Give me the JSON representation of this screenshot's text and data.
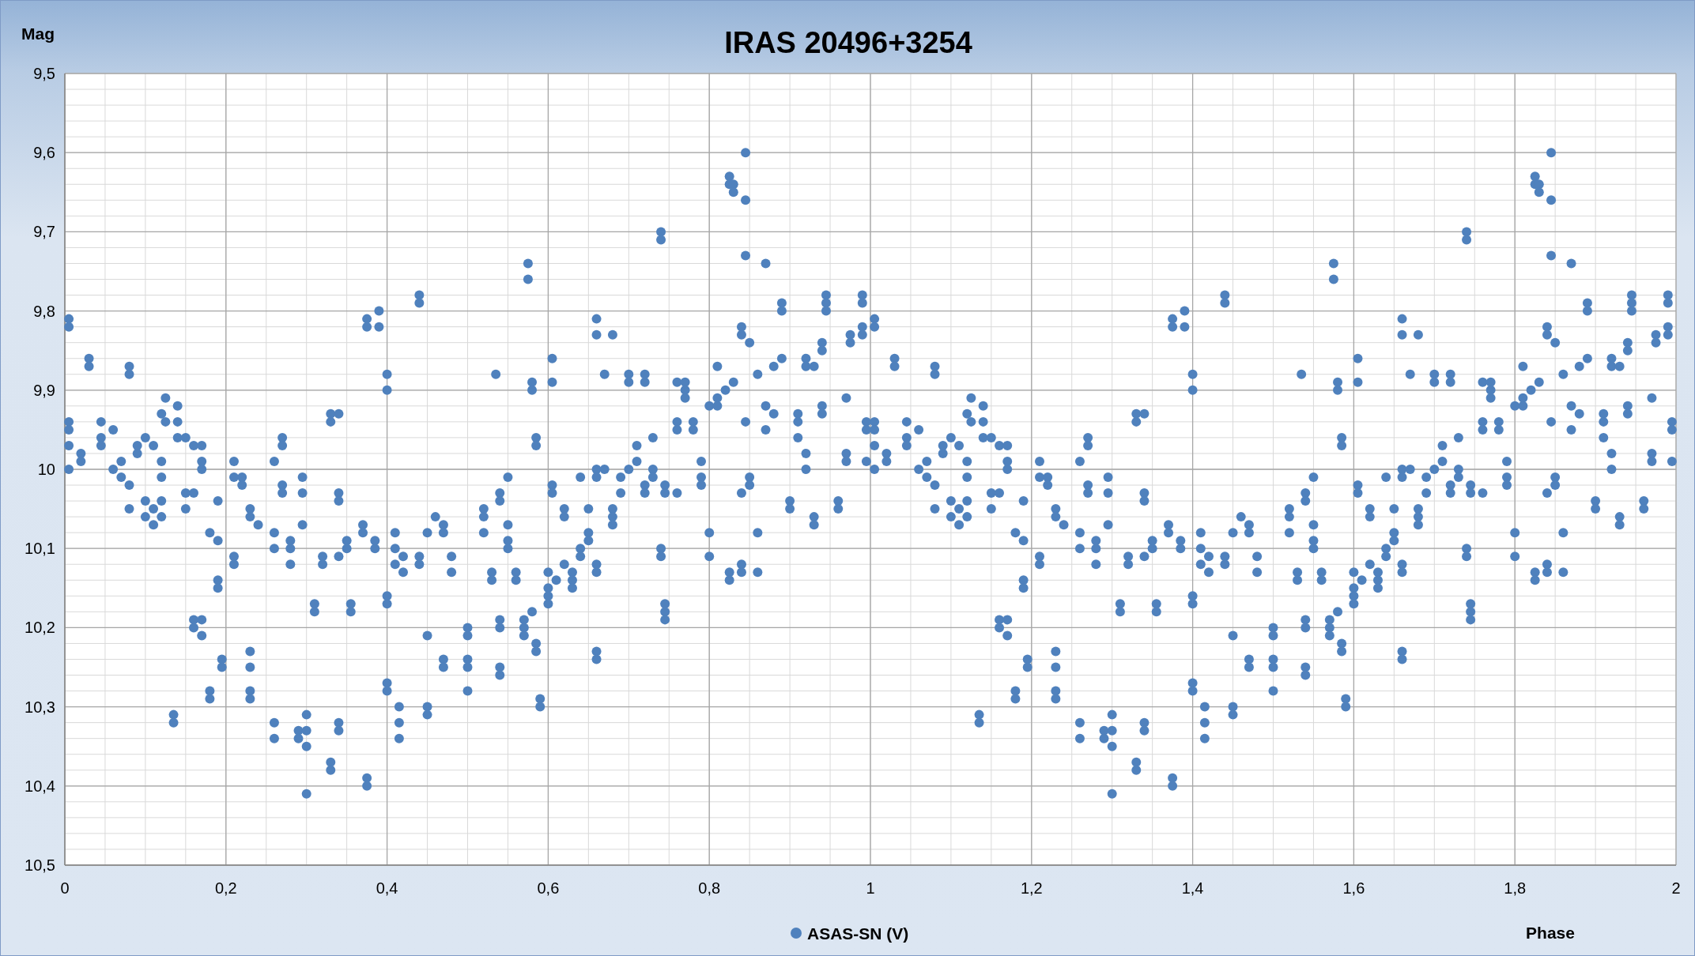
{
  "chart": {
    "chart_data": {
      "type": "scatter",
      "title": "IRAS 20496+3254",
      "xlabel": "Phase",
      "ylabel": "Mag",
      "xlim": [
        0,
        2
      ],
      "ylim": [
        10.5,
        9.5
      ],
      "grid": true,
      "xticks": [
        {
          "value": 0,
          "label": "0"
        },
        {
          "value": 0.2,
          "label": "0,2"
        },
        {
          "value": 0.4,
          "label": "0,4"
        },
        {
          "value": 0.6,
          "label": "0,6"
        },
        {
          "value": 0.8,
          "label": "0,8"
        },
        {
          "value": 1,
          "label": "1"
        },
        {
          "value": 1.2,
          "label": "1,2"
        },
        {
          "value": 1.4,
          "label": "1,4"
        },
        {
          "value": 1.6,
          "label": "1,6"
        },
        {
          "value": 1.8,
          "label": "1,8"
        },
        {
          "value": 2,
          "label": "2"
        }
      ],
      "yticks": [
        {
          "value": 9.5,
          "label": "9,5"
        },
        {
          "value": 9.6,
          "label": "9,6"
        },
        {
          "value": 9.7,
          "label": "9,7"
        },
        {
          "value": 9.8,
          "label": "9,8"
        },
        {
          "value": 9.9,
          "label": "9,9"
        },
        {
          "value": 10,
          "label": "10"
        },
        {
          "value": 10.1,
          "label": "10,1"
        },
        {
          "value": 10.2,
          "label": "10,2"
        },
        {
          "value": 10.3,
          "label": "10,3"
        },
        {
          "value": 10.4,
          "label": "10,4"
        },
        {
          "value": 10.5,
          "label": "10,5"
        }
      ],
      "x": [
        0.005,
        0.005,
        0.005,
        0.005,
        0.005,
        0.005,
        0.02,
        0.02,
        0.03,
        0.03,
        0.045,
        0.045,
        0.045,
        0.06,
        0.06,
        0.07,
        0.07,
        0.08,
        0.08,
        0.08,
        0.08,
        0.09,
        0.09,
        0.1,
        0.1,
        0.1,
        0.11,
        0.11,
        0.11,
        0.12,
        0.12,
        0.12,
        0.12,
        0.12,
        0.125,
        0.125,
        0.135,
        0.135,
        0.14,
        0.14,
        0.14,
        0.15,
        0.15,
        0.15,
        0.16,
        0.16,
        0.16,
        0.16,
        0.17,
        0.17,
        0.17,
        0.17,
        0.17,
        0.18,
        0.18,
        0.18,
        0.19,
        0.19,
        0.19,
        0.19,
        0.195,
        0.195,
        0.21,
        0.21,
        0.21,
        0.21,
        0.22,
        0.22,
        0.23,
        0.23,
        0.23,
        0.23,
        0.23,
        0.23,
        0.24,
        0.26,
        0.26,
        0.26,
        0.26,
        0.26,
        0.27,
        0.27,
        0.27,
        0.27,
        0.28,
        0.28,
        0.28,
        0.29,
        0.29,
        0.295,
        0.295,
        0.295,
        0.3,
        0.3,
        0.3,
        0.3,
        0.31,
        0.31,
        0.32,
        0.32,
        0.33,
        0.33,
        0.33,
        0.33,
        0.34,
        0.34,
        0.34,
        0.34,
        0.34,
        0.34,
        0.35,
        0.35,
        0.355,
        0.355,
        0.37,
        0.37,
        0.375,
        0.375,
        0.375,
        0.375,
        0.385,
        0.385,
        0.39,
        0.39,
        0.4,
        0.4,
        0.4,
        0.4,
        0.4,
        0.4,
        0.41,
        0.41,
        0.41,
        0.415,
        0.415,
        0.415,
        0.42,
        0.42,
        0.44,
        0.44,
        0.44,
        0.44,
        0.45,
        0.45,
        0.45,
        0.45,
        0.46,
        0.47,
        0.47,
        0.47,
        0.47,
        0.48,
        0.48,
        0.5,
        0.5,
        0.5,
        0.5,
        0.5,
        0.52,
        0.52,
        0.52,
        0.53,
        0.53,
        0.535,
        0.54,
        0.54,
        0.54,
        0.54,
        0.54,
        0.54,
        0.55,
        0.55,
        0.55,
        0.55,
        0.56,
        0.56,
        0.57,
        0.57,
        0.57,
        0.575,
        0.575,
        0.58,
        0.58,
        0.58,
        0.585,
        0.585,
        0.585,
        0.585,
        0.59,
        0.59,
        0.6,
        0.6,
        0.6,
        0.6,
        0.605,
        0.605,
        0.605,
        0.605,
        0.61,
        0.62,
        0.62,
        0.62,
        0.63,
        0.63,
        0.63,
        0.64,
        0.64,
        0.64,
        0.65,
        0.65,
        0.65,
        0.66,
        0.66,
        0.66,
        0.66,
        0.66,
        0.66,
        0.66,
        0.66,
        0.67,
        0.67,
        0.68,
        0.68,
        0.68,
        0.68,
        0.69,
        0.69,
        0.7,
        0.7,
        0.7,
        0.71,
        0.71,
        0.72,
        0.72,
        0.72,
        0.72,
        0.73,
        0.73,
        0.73,
        0.74,
        0.74,
        0.74,
        0.74,
        0.745,
        0.745,
        0.745,
        0.745,
        0.745,
        0.76,
        0.76,
        0.76,
        0.76,
        0.77,
        0.77,
        0.77,
        0.78,
        0.78,
        0.79,
        0.79,
        0.79,
        0.8,
        0.8,
        0.8,
        0.81,
        0.81,
        0.81,
        0.82,
        0.825,
        0.825,
        0.825,
        0.825,
        0.83,
        0.83,
        0.83,
        0.84,
        0.84,
        0.84,
        0.84,
        0.84,
        0.845,
        0.845,
        0.845,
        0.845,
        0.85,
        0.85,
        0.85,
        0.86,
        0.86,
        0.86,
        0.87,
        0.87,
        0.87,
        0.88,
        0.88,
        0.89,
        0.89,
        0.89,
        0.9,
        0.9,
        0.91,
        0.91,
        0.91,
        0.92,
        0.92,
        0.92,
        0.92,
        0.93,
        0.93,
        0.93,
        0.94,
        0.94,
        0.94,
        0.94,
        0.945,
        0.945,
        0.945,
        0.96,
        0.96,
        0.97,
        0.97,
        0.97,
        0.975,
        0.975,
        0.99,
        0.99,
        0.99,
        0.99,
        0.995,
        0.995,
        0.995,
        1.005,
        1.005,
        1.005,
        1.005,
        1.005,
        1.005,
        1.02,
        1.02,
        1.03,
        1.03,
        1.045,
        1.045,
        1.045,
        1.06,
        1.06,
        1.07,
        1.07,
        1.08,
        1.08,
        1.08,
        1.08,
        1.09,
        1.09,
        1.1,
        1.1,
        1.1,
        1.11,
        1.11,
        1.11,
        1.12,
        1.12,
        1.12,
        1.12,
        1.12,
        1.125,
        1.125,
        1.135,
        1.135,
        1.14,
        1.14,
        1.14,
        1.15,
        1.15,
        1.15,
        1.16,
        1.16,
        1.16,
        1.16,
        1.17,
        1.17,
        1.17,
        1.17,
        1.17,
        1.18,
        1.18,
        1.18,
        1.19,
        1.19,
        1.19,
        1.19,
        1.195,
        1.195,
        1.21,
        1.21,
        1.21,
        1.21,
        1.22,
        1.22,
        1.23,
        1.23,
        1.23,
        1.23,
        1.23,
        1.23,
        1.24,
        1.26,
        1.26,
        1.26,
        1.26,
        1.26,
        1.27,
        1.27,
        1.27,
        1.27,
        1.28,
        1.28,
        1.28,
        1.29,
        1.29,
        1.295,
        1.295,
        1.295,
        1.3,
        1.3,
        1.3,
        1.3,
        1.31,
        1.31,
        1.32,
        1.32,
        1.33,
        1.33,
        1.33,
        1.33,
        1.34,
        1.34,
        1.34,
        1.34,
        1.34,
        1.34,
        1.35,
        1.35,
        1.355,
        1.355,
        1.37,
        1.37,
        1.375,
        1.375,
        1.375,
        1.375,
        1.385,
        1.385,
        1.39,
        1.39,
        1.4,
        1.4,
        1.4,
        1.4,
        1.4,
        1.4,
        1.41,
        1.41,
        1.41,
        1.415,
        1.415,
        1.415,
        1.42,
        1.42,
        1.44,
        1.44,
        1.44,
        1.44,
        1.45,
        1.45,
        1.45,
        1.45,
        1.46,
        1.47,
        1.47,
        1.47,
        1.47,
        1.48,
        1.48,
        1.5,
        1.5,
        1.5,
        1.5,
        1.5,
        1.52,
        1.52,
        1.52,
        1.53,
        1.53,
        1.535,
        1.54,
        1.54,
        1.54,
        1.54,
        1.54,
        1.54,
        1.55,
        1.55,
        1.55,
        1.55,
        1.56,
        1.56,
        1.57,
        1.57,
        1.57,
        1.575,
        1.575,
        1.58,
        1.58,
        1.58,
        1.585,
        1.585,
        1.585,
        1.585,
        1.59,
        1.59,
        1.6,
        1.6,
        1.6,
        1.6,
        1.605,
        1.605,
        1.605,
        1.605,
        1.61,
        1.62,
        1.62,
        1.62,
        1.63,
        1.63,
        1.63,
        1.64,
        1.64,
        1.64,
        1.65,
        1.65,
        1.65,
        1.66,
        1.66,
        1.66,
        1.66,
        1.66,
        1.66,
        1.66,
        1.66,
        1.67,
        1.67,
        1.68,
        1.68,
        1.68,
        1.68,
        1.69,
        1.69,
        1.7,
        1.7,
        1.7,
        1.71,
        1.71,
        1.72,
        1.72,
        1.72,
        1.72,
        1.73,
        1.73,
        1.73,
        1.74,
        1.74,
        1.74,
        1.74,
        1.745,
        1.745,
        1.745,
        1.745,
        1.745,
        1.76,
        1.76,
        1.76,
        1.76,
        1.77,
        1.77,
        1.77,
        1.78,
        1.78,
        1.79,
        1.79,
        1.79,
        1.8,
        1.8,
        1.8,
        1.81,
        1.81,
        1.81,
        1.82,
        1.825,
        1.825,
        1.825,
        1.825,
        1.83,
        1.83,
        1.83,
        1.84,
        1.84,
        1.84,
        1.84,
        1.84,
        1.845,
        1.845,
        1.845,
        1.845,
        1.85,
        1.85,
        1.85,
        1.86,
        1.86,
        1.86,
        1.87,
        1.87,
        1.87,
        1.88,
        1.88,
        1.89,
        1.89,
        1.89,
        1.9,
        1.9,
        1.91,
        1.91,
        1.91,
        1.92,
        1.92,
        1.92,
        1.92,
        1.93,
        1.93,
        1.93,
        1.94,
        1.94,
        1.94,
        1.94,
        1.945,
        1.945,
        1.945,
        1.96,
        1.96,
        1.97,
        1.97,
        1.97,
        1.975,
        1.975,
        1.99,
        1.99,
        1.99,
        1.99,
        1.995,
        1.995,
        1.995
      ],
      "series": [
        {
          "name": "ASAS-SN (V)",
          "color": "#4f81bd",
          "values": [
            9.81,
            9.82,
            9.94,
            9.95,
            9.97,
            10.0,
            9.98,
            9.99,
            9.86,
            9.87,
            9.94,
            9.96,
            9.97,
            9.95,
            10.0,
            9.99,
            10.01,
            9.87,
            9.88,
            10.02,
            10.05,
            9.97,
            9.98,
            10.04,
            10.06,
            9.96,
            10.05,
            10.07,
            9.97,
            9.93,
            9.99,
            10.01,
            10.04,
            10.06,
            9.91,
            9.94,
            10.31,
            10.32,
            9.92,
            9.94,
            9.96,
            9.96,
            10.03,
            10.05,
            10.19,
            10.2,
            9.97,
            10.03,
            10.19,
            10.21,
            9.97,
            9.99,
            10.0,
            10.28,
            10.29,
            10.08,
            10.14,
            10.15,
            10.04,
            10.09,
            10.24,
            10.25,
            9.99,
            10.01,
            10.11,
            10.12,
            10.01,
            10.02,
            10.23,
            10.25,
            10.28,
            10.29,
            10.05,
            10.06,
            10.07,
            9.99,
            10.08,
            10.1,
            10.32,
            10.34,
            9.96,
            9.97,
            10.02,
            10.03,
            10.09,
            10.1,
            10.12,
            10.33,
            10.34,
            10.01,
            10.03,
            10.07,
            10.35,
            10.33,
            10.31,
            10.41,
            10.17,
            10.18,
            10.11,
            10.12,
            10.37,
            10.38,
            9.93,
            9.94,
            10.03,
            10.04,
            10.11,
            10.32,
            10.33,
            9.93,
            10.09,
            10.1,
            10.17,
            10.18,
            10.07,
            10.08,
            10.39,
            10.4,
            9.81,
            9.82,
            10.09,
            10.1,
            9.8,
            9.82,
            9.88,
            9.9,
            10.16,
            10.17,
            10.27,
            10.28,
            10.08,
            10.1,
            10.12,
            10.3,
            10.32,
            10.34,
            10.11,
            10.13,
            9.78,
            9.79,
            10.11,
            10.12,
            10.3,
            10.31,
            10.08,
            10.21,
            10.06,
            10.07,
            10.08,
            10.24,
            10.25,
            10.11,
            10.13,
            10.2,
            10.21,
            10.24,
            10.25,
            10.28,
            10.05,
            10.06,
            10.08,
            10.13,
            10.14,
            9.88,
            10.19,
            10.2,
            10.25,
            10.26,
            10.03,
            10.04,
            10.07,
            10.09,
            10.1,
            10.01,
            10.13,
            10.14,
            10.19,
            10.2,
            10.21,
            9.74,
            9.76,
            9.89,
            9.9,
            10.18,
            9.96,
            9.97,
            10.22,
            10.23,
            10.29,
            10.3,
            10.13,
            10.15,
            10.16,
            10.17,
            10.02,
            10.03,
            9.86,
            9.89,
            10.14,
            10.05,
            10.06,
            10.12,
            10.13,
            10.14,
            10.15,
            10.01,
            10.1,
            10.11,
            10.05,
            10.08,
            10.09,
            10.0,
            10.01,
            10.12,
            10.13,
            10.23,
            10.24,
            9.81,
            9.83,
            9.88,
            10.0,
            9.83,
            10.05,
            10.06,
            10.07,
            10.01,
            10.03,
            10.0,
            9.88,
            9.89,
            9.97,
            9.99,
            9.88,
            9.89,
            10.02,
            10.03,
            10.0,
            10.01,
            9.96,
            9.7,
            9.71,
            10.1,
            10.11,
            10.17,
            10.18,
            10.19,
            10.02,
            10.03,
            9.89,
            9.94,
            9.95,
            10.03,
            9.89,
            9.9,
            9.91,
            9.94,
            9.95,
            10.01,
            10.02,
            9.99,
            10.08,
            10.11,
            9.92,
            9.87,
            9.91,
            9.92,
            9.9,
            9.63,
            9.64,
            10.13,
            10.14,
            9.64,
            9.65,
            9.89,
            9.82,
            9.83,
            10.03,
            10.12,
            10.13,
            9.6,
            9.66,
            9.73,
            9.94,
            10.01,
            10.02,
            9.84,
            10.13,
            10.08,
            9.88,
            9.74,
            9.92,
            9.95,
            9.87,
            9.93,
            9.79,
            9.8,
            9.86,
            10.04,
            10.05,
            9.93,
            9.94,
            9.96,
            9.86,
            9.87,
            9.98,
            10.0,
            9.87,
            10.06,
            10.07,
            9.84,
            9.85,
            9.92,
            9.93,
            9.78,
            9.79,
            9.8,
            10.04,
            10.05,
            9.91,
            9.98,
            9.99,
            9.83,
            9.84,
            9.78,
            9.79,
            9.82,
            9.83,
            9.94,
            9.95,
            9.99,
            9.81,
            9.82,
            9.94,
            9.95,
            9.97,
            10.0,
            9.98,
            9.99,
            9.86,
            9.87,
            9.94,
            9.96,
            9.97,
            9.95,
            10.0,
            9.99,
            10.01,
            9.87,
            9.88,
            10.02,
            10.05,
            9.97,
            9.98,
            10.04,
            10.06,
            9.96,
            10.05,
            10.07,
            9.97,
            9.93,
            9.99,
            10.01,
            10.04,
            10.06,
            9.91,
            9.94,
            10.31,
            10.32,
            9.92,
            9.94,
            9.96,
            9.96,
            10.03,
            10.05,
            10.19,
            10.2,
            9.97,
            10.03,
            10.19,
            10.21,
            9.97,
            9.99,
            10.0,
            10.28,
            10.29,
            10.08,
            10.14,
            10.15,
            10.04,
            10.09,
            10.24,
            10.25,
            9.99,
            10.01,
            10.11,
            10.12,
            10.01,
            10.02,
            10.23,
            10.25,
            10.28,
            10.29,
            10.05,
            10.06,
            10.07,
            9.99,
            10.08,
            10.1,
            10.32,
            10.34,
            9.96,
            9.97,
            10.02,
            10.03,
            10.09,
            10.1,
            10.12,
            10.33,
            10.34,
            10.01,
            10.03,
            10.07,
            10.35,
            10.33,
            10.31,
            10.41,
            10.17,
            10.18,
            10.11,
            10.12,
            10.37,
            10.38,
            9.93,
            9.94,
            10.03,
            10.04,
            10.11,
            10.32,
            10.33,
            9.93,
            10.09,
            10.1,
            10.17,
            10.18,
            10.07,
            10.08,
            10.39,
            10.4,
            9.81,
            9.82,
            10.09,
            10.1,
            9.8,
            9.82,
            9.88,
            9.9,
            10.16,
            10.17,
            10.27,
            10.28,
            10.08,
            10.1,
            10.12,
            10.3,
            10.32,
            10.34,
            10.11,
            10.13,
            9.78,
            9.79,
            10.11,
            10.12,
            10.3,
            10.31,
            10.08,
            10.21,
            10.06,
            10.07,
            10.08,
            10.24,
            10.25,
            10.11,
            10.13,
            10.2,
            10.21,
            10.24,
            10.25,
            10.28,
            10.05,
            10.06,
            10.08,
            10.13,
            10.14,
            9.88,
            10.19,
            10.2,
            10.25,
            10.26,
            10.03,
            10.04,
            10.07,
            10.09,
            10.1,
            10.01,
            10.13,
            10.14,
            10.19,
            10.2,
            10.21,
            9.74,
            9.76,
            9.89,
            9.9,
            10.18,
            9.96,
            9.97,
            10.22,
            10.23,
            10.29,
            10.3,
            10.13,
            10.15,
            10.16,
            10.17,
            10.02,
            10.03,
            9.86,
            9.89,
            10.14,
            10.05,
            10.06,
            10.12,
            10.13,
            10.14,
            10.15,
            10.01,
            10.1,
            10.11,
            10.05,
            10.08,
            10.09,
            10.0,
            10.01,
            10.12,
            10.13,
            10.23,
            10.24,
            9.81,
            9.83,
            9.88,
            10.0,
            9.83,
            10.05,
            10.06,
            10.07,
            10.01,
            10.03,
            10.0,
            9.88,
            9.89,
            9.97,
            9.99,
            9.88,
            9.89,
            10.02,
            10.03,
            10.0,
            10.01,
            9.96,
            9.7,
            9.71,
            10.1,
            10.11,
            10.17,
            10.18,
            10.19,
            10.02,
            10.03,
            9.89,
            9.94,
            9.95,
            10.03,
            9.89,
            9.9,
            9.91,
            9.94,
            9.95,
            10.01,
            10.02,
            9.99,
            10.08,
            10.11,
            9.92,
            9.87,
            9.91,
            9.92,
            9.9,
            9.63,
            9.64,
            10.13,
            10.14,
            9.64,
            9.65,
            9.89,
            9.82,
            9.83,
            10.03,
            10.12,
            10.13,
            9.6,
            9.66,
            9.73,
            9.94,
            10.01,
            10.02,
            9.84,
            10.13,
            10.08,
            9.88,
            9.74,
            9.92,
            9.95,
            9.87,
            9.93,
            9.79,
            9.8,
            9.86,
            10.04,
            10.05,
            9.93,
            9.94,
            9.96,
            9.86,
            9.87,
            9.98,
            10.0,
            9.87,
            10.06,
            10.07,
            9.84,
            9.85,
            9.92,
            9.93,
            9.78,
            9.79,
            9.8,
            10.04,
            10.05,
            9.91,
            9.98,
            9.99,
            9.83,
            9.84,
            9.78,
            9.79,
            9.82,
            9.83,
            9.94,
            9.95,
            9.99
          ]
        }
      ]
    }
  }
}
